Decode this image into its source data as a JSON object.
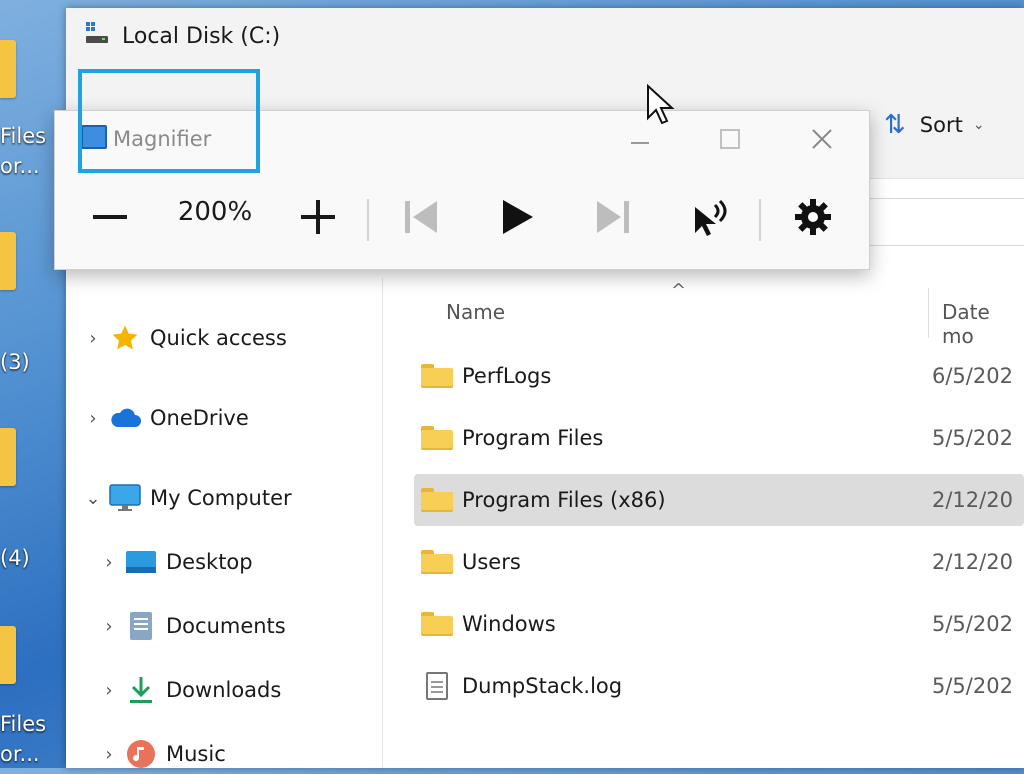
{
  "desktop": {
    "labels": [
      "Files",
      "or...",
      "(3)",
      "(4)",
      "Files",
      "or..."
    ]
  },
  "explorer": {
    "title": "Local Disk (C:)",
    "sort_label": "Sort",
    "columns": {
      "name": "Name",
      "date": "Date mo"
    },
    "nav": [
      {
        "label": "Quick access",
        "icon": "star-icon",
        "expanded": false,
        "indent": 0
      },
      {
        "label": "OneDrive",
        "icon": "cloud-icon",
        "expanded": false,
        "indent": 0
      },
      {
        "label": "My Computer",
        "icon": "monitor-icon",
        "expanded": true,
        "indent": 0
      },
      {
        "label": "Desktop",
        "icon": "desktop-icon",
        "expanded": false,
        "indent": 1
      },
      {
        "label": "Documents",
        "icon": "documents-icon",
        "expanded": false,
        "indent": 1
      },
      {
        "label": "Downloads",
        "icon": "download-icon",
        "expanded": false,
        "indent": 1
      },
      {
        "label": "Music",
        "icon": "music-icon",
        "expanded": false,
        "indent": 1
      }
    ],
    "files": [
      {
        "name": "PerfLogs",
        "date": "6/5/202",
        "type": "folder",
        "selected": false
      },
      {
        "name": "Program Files",
        "date": "5/5/202",
        "type": "folder",
        "selected": false
      },
      {
        "name": "Program Files (x86)",
        "date": "2/12/20",
        "type": "folder",
        "selected": true
      },
      {
        "name": "Users",
        "date": "2/12/20",
        "type": "folder",
        "selected": false
      },
      {
        "name": "Windows",
        "date": "5/5/202",
        "type": "folder",
        "selected": false
      },
      {
        "name": "DumpStack.log",
        "date": "5/5/202",
        "type": "file",
        "selected": false
      }
    ]
  },
  "magnifier": {
    "title": "Magnifier",
    "zoom": "200%"
  },
  "colors": {
    "accent": "#1fa3e0",
    "folder": "#f8cf55",
    "selection": "#dcdcdc"
  }
}
